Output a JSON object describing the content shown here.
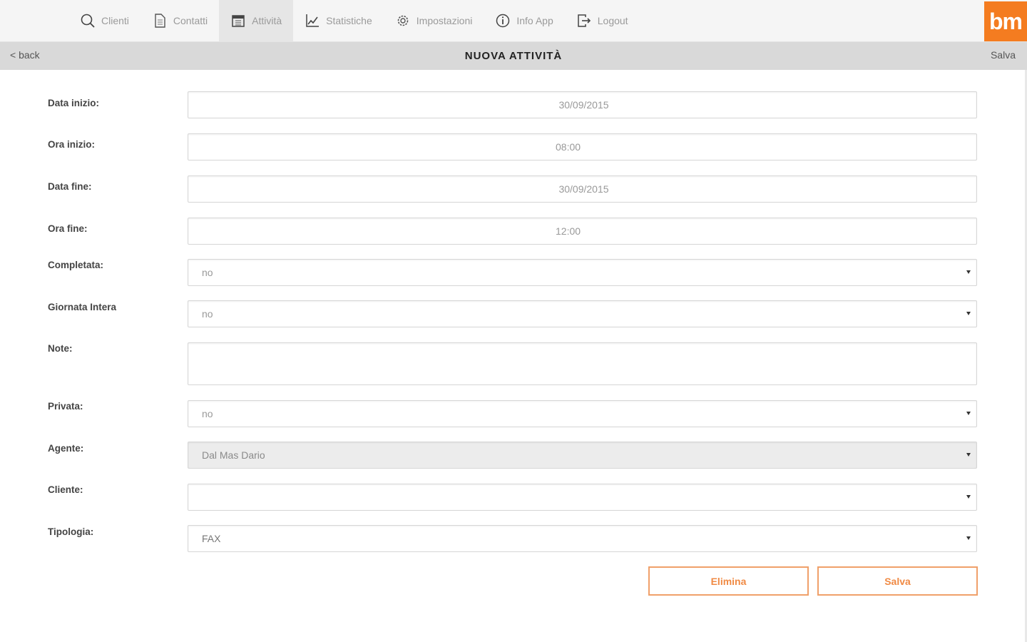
{
  "nav": {
    "items": [
      {
        "label": "Clienti",
        "icon": "search-icon"
      },
      {
        "label": "Contatti",
        "icon": "document-icon"
      },
      {
        "label": "Attività",
        "icon": "calendar-icon"
      },
      {
        "label": "Statistiche",
        "icon": "chart-icon"
      },
      {
        "label": "Impostazioni",
        "icon": "gear-icon"
      },
      {
        "label": "Info App",
        "icon": "info-icon"
      },
      {
        "label": "Logout",
        "icon": "logout-icon"
      }
    ],
    "active": "Attività",
    "logo_text": "bm",
    "accent_color": "#f47c20"
  },
  "titlebar": {
    "back_label": "< back",
    "title": "NUOVA ATTIVITÀ",
    "save_label": "Salva"
  },
  "form": {
    "data_inizio": {
      "label": "Data inizio:",
      "value": "30/09/2015"
    },
    "ora_inizio": {
      "label": "Ora inizio:",
      "value": "08:00"
    },
    "data_fine": {
      "label": "Data fine:",
      "value": "30/09/2015"
    },
    "ora_fine": {
      "label": "Ora fine:",
      "value": "12:00"
    },
    "completata": {
      "label": "Completata:",
      "value": "no"
    },
    "giornata_intera": {
      "label": "Giornata Intera",
      "value": "no"
    },
    "note": {
      "label": "Note:",
      "value": ""
    },
    "privata": {
      "label": "Privata:",
      "value": "no"
    },
    "agente": {
      "label": "Agente:",
      "value": "Dal Mas Dario"
    },
    "cliente": {
      "label": "Cliente:",
      "value": ""
    },
    "tipologia": {
      "label": "Tipologia:",
      "value": "FAX"
    }
  },
  "buttons": {
    "delete_label": "Elimina",
    "save_label": "Salva"
  }
}
